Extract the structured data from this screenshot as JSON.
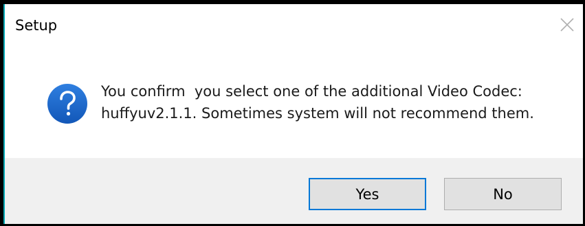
{
  "window": {
    "title": "Setup"
  },
  "message": {
    "icon": "question-icon",
    "line1": "You confirm  you select one of the additional Video Codec:",
    "line2": "huffyuv2.1.1. Sometimes system will not recommend them."
  },
  "buttons": {
    "yes_label": "Yes",
    "no_label": "No",
    "default": "yes"
  },
  "colors": {
    "icon_blue": "#1e6bd1",
    "default_button_border": "#0078d7",
    "button_bar_background": "#f0f0f0"
  }
}
